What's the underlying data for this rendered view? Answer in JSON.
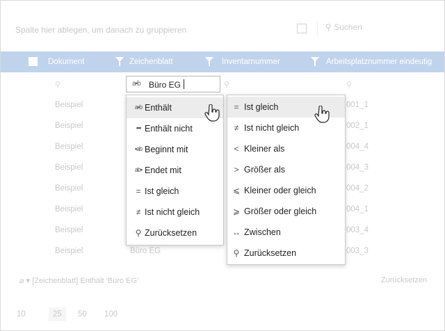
{
  "toolbar": {
    "group_hint": "Spalte hier ablegen, um danach zu gruppieren",
    "search_placeholder": "Suchen"
  },
  "header": {
    "columns": [
      "Dokument",
      "Zeichenblatt",
      "Inventarnummer",
      "Arbeitsplatznummer eindeutig"
    ]
  },
  "filter_row": {
    "active_value": "Büro EG"
  },
  "rows": [
    {
      "c1": "Beispiel",
      "c2": "",
      "c4": "001_1"
    },
    {
      "c1": "Beispiel",
      "c2": "",
      "c4": "002_1"
    },
    {
      "c1": "Beispiel",
      "c2": "",
      "c4": "004_4"
    },
    {
      "c1": "Beispiel",
      "c2": "",
      "c4": "004_3"
    },
    {
      "c1": "Beispiel",
      "c2": "",
      "c4": "004_2"
    },
    {
      "c1": "Beispiel",
      "c2": "",
      "c4": "004_1"
    },
    {
      "c1": "Beispiel",
      "c2": "",
      "c4": "003_4"
    },
    {
      "c1": "Beispiel",
      "c2": "Büro EG",
      "c4": "003_3"
    }
  ],
  "footer": {
    "filter_text": "[Zeichenblatt] Enthält 'Büro EG'",
    "reset": "Zurücksetzen"
  },
  "pager": [
    "10",
    "25",
    "50",
    "100"
  ],
  "menu_primary": [
    {
      "icon": "contains-icon",
      "label": "Enthält"
    },
    {
      "icon": "not-contains-icon",
      "label": "Enthält nicht"
    },
    {
      "icon": "starts-with-icon",
      "label": "Beginnt mit"
    },
    {
      "icon": "ends-with-icon",
      "label": "Endet mit"
    },
    {
      "icon": "equals-icon",
      "label": "Ist gleich"
    },
    {
      "icon": "not-equals-icon",
      "label": "Ist nicht gleich"
    },
    {
      "icon": "search-icon",
      "label": "Zurücksetzen"
    }
  ],
  "menu_secondary": [
    {
      "icon": "equals-icon",
      "label": "Ist gleich"
    },
    {
      "icon": "not-equals-icon",
      "label": "Ist nicht gleich"
    },
    {
      "icon": "less-than-icon",
      "label": "Kleiner als"
    },
    {
      "icon": "greater-than-icon",
      "label": "Größer als"
    },
    {
      "icon": "less-or-equal-icon",
      "label": "Kleiner oder gleich"
    },
    {
      "icon": "greater-or-equal-icon",
      "label": "Größer oder gleich"
    },
    {
      "icon": "between-icon",
      "label": "Zwischen"
    },
    {
      "icon": "search-icon",
      "label": "Zurücksetzen"
    }
  ]
}
